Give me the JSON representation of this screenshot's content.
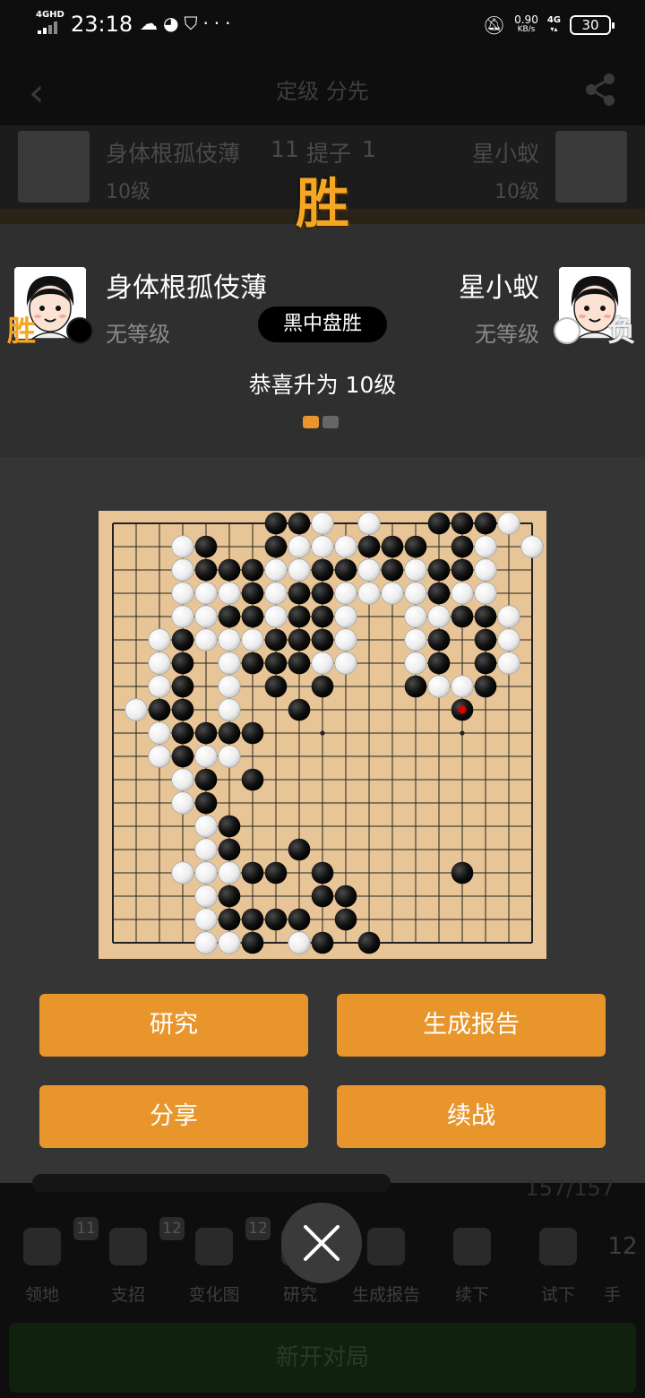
{
  "status_bar": {
    "network_type": "4GHD",
    "time": "23:18",
    "speed_value": "0.90",
    "speed_unit": "KB/s",
    "network_right": "4G",
    "battery": "30"
  },
  "background_app": {
    "title": "定级 分先",
    "black_player": "身体根孤伎薄",
    "black_rank": "10级",
    "white_player": "星小蚁",
    "white_rank": "10级",
    "territory_count": "11",
    "captures_label": "提子",
    "captures_count": "1",
    "move_counter": "157/157",
    "tools": [
      {
        "label": "领地",
        "badge": "11"
      },
      {
        "label": "支招",
        "badge": "12"
      },
      {
        "label": "变化图",
        "badge": "12"
      },
      {
        "label": "研究"
      },
      {
        "label": "生成报告"
      },
      {
        "label": "续下"
      },
      {
        "label": "试下"
      },
      {
        "label": "手",
        "badge": "12"
      }
    ],
    "new_game_label": "新开对局"
  },
  "result_popup": {
    "headline": "胜",
    "black_player": {
      "name": "身体根孤伎薄",
      "rank": "无等级",
      "badge": "胜",
      "stone": "black"
    },
    "white_player": {
      "name": "星小蚁",
      "rank": "无等级",
      "badge": "负",
      "stone": "white"
    },
    "result_label": "黑中盘胜",
    "congrats_text": "恭喜升为 10级",
    "page_indicator": {
      "pages": 2,
      "active": 1
    },
    "buttons": {
      "research": "研究",
      "report": "生成报告",
      "share": "分享",
      "continue": "续战"
    }
  },
  "board": {
    "size": 19,
    "last_move": [
      15,
      8
    ],
    "black": [
      [
        7,
        0
      ],
      [
        8,
        0
      ],
      [
        14,
        0
      ],
      [
        15,
        0
      ],
      [
        16,
        0
      ],
      [
        4,
        1
      ],
      [
        7,
        1
      ],
      [
        11,
        1
      ],
      [
        12,
        1
      ],
      [
        13,
        1
      ],
      [
        15,
        1
      ],
      [
        4,
        2
      ],
      [
        5,
        2
      ],
      [
        6,
        2
      ],
      [
        9,
        2
      ],
      [
        10,
        2
      ],
      [
        12,
        2
      ],
      [
        14,
        2
      ],
      [
        15,
        2
      ],
      [
        6,
        3
      ],
      [
        8,
        3
      ],
      [
        9,
        3
      ],
      [
        14,
        3
      ],
      [
        5,
        4
      ],
      [
        6,
        4
      ],
      [
        8,
        4
      ],
      [
        9,
        4
      ],
      [
        15,
        4
      ],
      [
        16,
        4
      ],
      [
        3,
        5
      ],
      [
        7,
        5
      ],
      [
        8,
        5
      ],
      [
        9,
        5
      ],
      [
        14,
        5
      ],
      [
        16,
        5
      ],
      [
        3,
        6
      ],
      [
        6,
        6
      ],
      [
        7,
        6
      ],
      [
        8,
        6
      ],
      [
        14,
        6
      ],
      [
        16,
        6
      ],
      [
        3,
        7
      ],
      [
        7,
        7
      ],
      [
        9,
        7
      ],
      [
        13,
        7
      ],
      [
        16,
        7
      ],
      [
        2,
        8
      ],
      [
        3,
        8
      ],
      [
        8,
        8
      ],
      [
        15,
        8
      ],
      [
        3,
        9
      ],
      [
        4,
        9
      ],
      [
        5,
        9
      ],
      [
        6,
        9
      ],
      [
        3,
        10
      ],
      [
        4,
        11
      ],
      [
        6,
        11
      ],
      [
        4,
        12
      ],
      [
        5,
        13
      ],
      [
        5,
        14
      ],
      [
        8,
        14
      ],
      [
        6,
        15
      ],
      [
        7,
        15
      ],
      [
        9,
        15
      ],
      [
        15,
        15
      ],
      [
        5,
        16
      ],
      [
        9,
        16
      ],
      [
        10,
        16
      ],
      [
        5,
        17
      ],
      [
        6,
        17
      ],
      [
        7,
        17
      ],
      [
        8,
        17
      ],
      [
        10,
        17
      ],
      [
        6,
        18
      ],
      [
        9,
        18
      ],
      [
        11,
        18
      ]
    ],
    "white": [
      [
        9,
        0
      ],
      [
        11,
        0
      ],
      [
        17,
        0
      ],
      [
        3,
        1
      ],
      [
        8,
        1
      ],
      [
        9,
        1
      ],
      [
        10,
        1
      ],
      [
        16,
        1
      ],
      [
        18,
        1
      ],
      [
        3,
        2
      ],
      [
        7,
        2
      ],
      [
        8,
        2
      ],
      [
        11,
        2
      ],
      [
        13,
        2
      ],
      [
        16,
        2
      ],
      [
        3,
        3
      ],
      [
        4,
        3
      ],
      [
        5,
        3
      ],
      [
        7,
        3
      ],
      [
        10,
        3
      ],
      [
        11,
        3
      ],
      [
        12,
        3
      ],
      [
        13,
        3
      ],
      [
        15,
        3
      ],
      [
        16,
        3
      ],
      [
        3,
        4
      ],
      [
        4,
        4
      ],
      [
        7,
        4
      ],
      [
        10,
        4
      ],
      [
        13,
        4
      ],
      [
        14,
        4
      ],
      [
        17,
        4
      ],
      [
        2,
        5
      ],
      [
        4,
        5
      ],
      [
        5,
        5
      ],
      [
        6,
        5
      ],
      [
        10,
        5
      ],
      [
        13,
        5
      ],
      [
        17,
        5
      ],
      [
        2,
        6
      ],
      [
        5,
        6
      ],
      [
        9,
        6
      ],
      [
        10,
        6
      ],
      [
        13,
        6
      ],
      [
        17,
        6
      ],
      [
        2,
        7
      ],
      [
        5,
        7
      ],
      [
        14,
        7
      ],
      [
        15,
        7
      ],
      [
        1,
        8
      ],
      [
        5,
        8
      ],
      [
        2,
        9
      ],
      [
        2,
        10
      ],
      [
        4,
        10
      ],
      [
        5,
        10
      ],
      [
        3,
        11
      ],
      [
        3,
        12
      ],
      [
        4,
        13
      ],
      [
        4,
        14
      ],
      [
        3,
        15
      ],
      [
        4,
        15
      ],
      [
        5,
        15
      ],
      [
        4,
        16
      ],
      [
        4,
        17
      ],
      [
        4,
        18
      ],
      [
        5,
        18
      ],
      [
        8,
        18
      ]
    ]
  },
  "colors": {
    "accent": "#e8962c",
    "win": "#f5a623",
    "board": "#e8c596",
    "last_move_marker": "#e00000"
  }
}
